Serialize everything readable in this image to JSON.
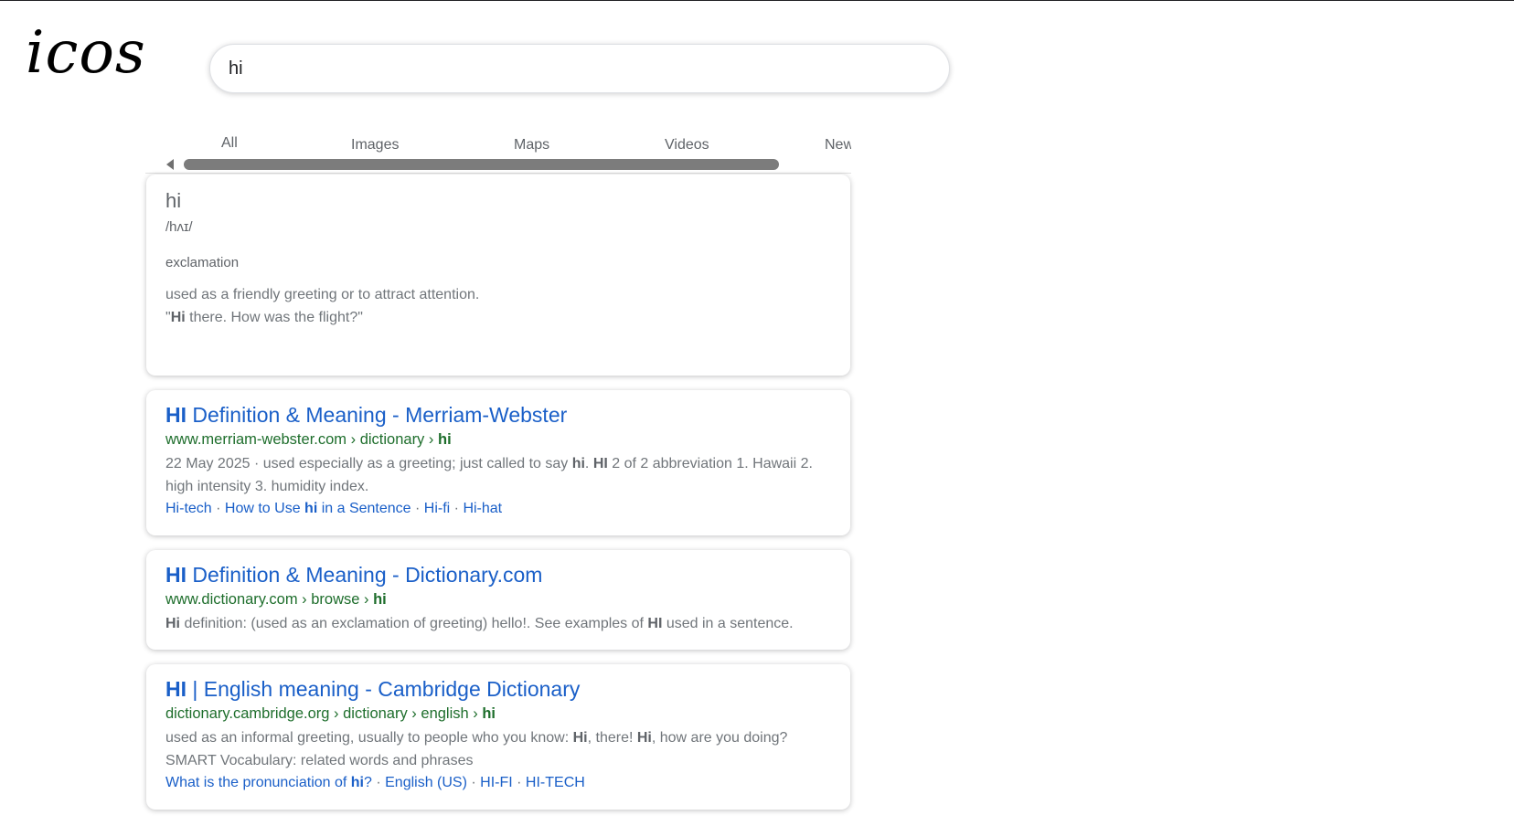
{
  "brand": {
    "logo": "icos"
  },
  "search": {
    "query": "hi"
  },
  "tabs": [
    {
      "label": "All"
    },
    {
      "label": "Images"
    },
    {
      "label": "Maps"
    },
    {
      "label": "Videos"
    },
    {
      "label": "New"
    }
  ],
  "definition": {
    "word": "hi",
    "phonetic": "/hʌɪ/",
    "part_of_speech": "exclamation",
    "meaning": "used as a friendly greeting or to attract attention.",
    "example_open_quote": "\"",
    "example_bold": "Hi",
    "example_rest": " there. How was the flight?\""
  },
  "results": [
    {
      "title_bold": "HI",
      "title_rest": " Definition & Meaning - Merriam-Webster",
      "url_plain": "www.merriam-webster.com › dictionary › ",
      "url_bold": "hi",
      "snippet_date": "22 May 2025",
      "snippet_dot": " · ",
      "snippet_1": "used especially as a greeting; just called to say ",
      "snippet_1_bold": "hi",
      "snippet_2": ". ",
      "snippet_2_bold": "HI",
      "snippet_3": " 2 of 2 abbreviation 1. Hawaii 2. high intensity 3. humidity index.",
      "sitelinks": {
        "link1": "Hi-tech",
        "link2_pre": "How to Use ",
        "link2_bold": "hi",
        "link2_post": " in a Sentence",
        "link3": "Hi-fi",
        "link4": "Hi-hat",
        "separator": " · "
      }
    },
    {
      "title_bold": "HI",
      "title_rest": " Definition & Meaning - Dictionary.com",
      "url_plain": "www.dictionary.com › browse › ",
      "url_bold": "hi",
      "snippet_1_bold": "Hi",
      "snippet_1": " definition: (used as an exclamation of greeting) hello!. See examples of ",
      "snippet_2_bold": "HI",
      "snippet_2": " used in a sentence."
    },
    {
      "title_bold": "HI",
      "title_rest": " | English meaning - Cambridge Dictionary",
      "url_plain": "dictionary.cambridge.org › dictionary › english › ",
      "url_bold": "hi",
      "snippet_1": "used as an informal greeting, usually to people who you know: ",
      "snippet_1_bold": "Hi",
      "snippet_2": ", there! ",
      "snippet_2_bold": "Hi",
      "snippet_3": ", how are you doing? SMART Vocabulary: related words and phrases",
      "sitelinks": {
        "link1_pre": "What is the pronunciation of ",
        "link1_bold": "hi",
        "link1_post": "?",
        "link2": "English (US)",
        "link3": "HI-FI",
        "link4": "HI-TECH",
        "separator": " · "
      }
    }
  ]
}
